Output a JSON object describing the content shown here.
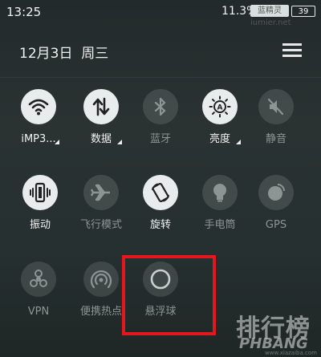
{
  "status_bar": {
    "time": "13:25",
    "battery_percent": "11.3%",
    "watermark_text": "蓝精灵 iumier.net",
    "battery_level": "39"
  },
  "header": {
    "date": "12月3日",
    "weekday": "周三",
    "menu_icon": "menu-lines-icon"
  },
  "tiles": [
    {
      "label": "iMP3...",
      "icon": "wifi-icon",
      "state": "on",
      "expand": true
    },
    {
      "label": "数据",
      "icon": "mobile-data-icon",
      "state": "on",
      "expand": true
    },
    {
      "label": "蓝牙",
      "icon": "bluetooth-icon",
      "state": "off",
      "expand": false
    },
    {
      "label": "亮度",
      "icon": "brightness-icon",
      "state": "on",
      "expand": true
    },
    {
      "label": "静音",
      "icon": "mute-icon",
      "state": "off",
      "expand": false
    },
    {
      "label": "振动",
      "icon": "vibrate-icon",
      "state": "on",
      "expand": false
    },
    {
      "label": "飞行模式",
      "icon": "airplane-icon",
      "state": "off",
      "expand": false
    },
    {
      "label": "旋转",
      "icon": "rotate-icon",
      "state": "on",
      "expand": false
    },
    {
      "label": "手电筒",
      "icon": "flashlight-icon",
      "state": "off",
      "expand": false
    },
    {
      "label": "GPS",
      "icon": "gps-icon",
      "state": "off",
      "expand": false
    },
    {
      "label": "VPN",
      "icon": "vpn-icon",
      "state": "off",
      "expand": false
    },
    {
      "label": "便携热点",
      "icon": "hotspot-icon",
      "state": "off",
      "expand": false
    },
    {
      "label": "悬浮球",
      "icon": "floating-ball-icon",
      "state": "off",
      "expand": false
    }
  ],
  "watermark": {
    "brand": "排行榜",
    "brand_en": "PHBANG",
    "url": "www.xiazaiba.com"
  },
  "colors": {
    "highlight_border": "#e3171d",
    "tile_on": "#e9ecec",
    "tile_off": "rgba(255,255,255,0.12)"
  }
}
